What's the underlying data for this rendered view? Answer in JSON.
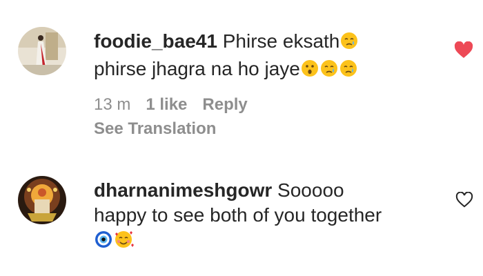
{
  "comments": [
    {
      "username": "foodie_bae41",
      "text_line1": " Phirse eksath",
      "text_line2": "phirse jhagra na ho jaye",
      "time": "13 m",
      "likes": "1 like",
      "reply": "Reply",
      "see_translation": "See Translation",
      "liked": true,
      "avatar_icon": "woman-saree-photo-avatar",
      "emojis_line1": [
        "crying-face-icon"
      ],
      "emojis_line2": [
        "astonished-face-icon",
        "crying-face-icon",
        "crying-face-icon"
      ]
    },
    {
      "username": "dharnanimeshgowr",
      "text_line1": " Sooooo",
      "text_line2": "happy to see both of you together",
      "liked": false,
      "avatar_icon": "deity-photo-avatar",
      "emojis_line3": [
        "nazar-amulet-icon",
        "smiling-face-with-hearts-icon"
      ]
    }
  ],
  "colors": {
    "heart_liked": "#ed4956",
    "meta_text": "#8e8e8e"
  }
}
